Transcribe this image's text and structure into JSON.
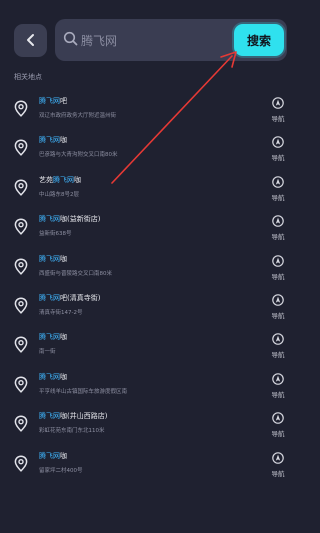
{
  "search": {
    "placeholder": "腾飞网",
    "button_label": "搜索"
  },
  "section_label": "相关地点",
  "results": [
    {
      "pre": "",
      "hl": "腾飞网",
      "post": "吧",
      "address": "双辽市政府政务大厅附近温州街",
      "nav_label": "导航"
    },
    {
      "pre": "",
      "hl": "腾飞网",
      "post": "咖",
      "address": "巴彦路与大青沟附交叉口南80米",
      "nav_label": "导航"
    },
    {
      "pre": "艺苑",
      "hl": "腾飞网",
      "post": "咖",
      "address": "中山路东8号2层",
      "nav_label": "导航"
    },
    {
      "pre": "",
      "hl": "腾飞网",
      "post": "咖(益新街店)",
      "address": "益新街638号",
      "nav_label": "导航"
    },
    {
      "pre": "",
      "hl": "腾飞网",
      "post": "咖",
      "address": "西盛街与晋陵路交叉口南80米",
      "nav_label": "导航"
    },
    {
      "pre": "",
      "hl": "腾飞网",
      "post": "吧(清真寺街)",
      "address": "清真寺街147-2号",
      "nav_label": "导航"
    },
    {
      "pre": "",
      "hl": "腾飞网",
      "post": "咖",
      "address": "南一街",
      "nav_label": "导航"
    },
    {
      "pre": "",
      "hl": "腾飞网",
      "post": "咖",
      "address": "平亨线羊山古镇国际车旅游度假区南",
      "nav_label": "导航"
    },
    {
      "pre": "",
      "hl": "腾飞网",
      "post": "咖(井山西路店)",
      "address": "彩虹花苑东南门东北110米",
      "nav_label": "导航"
    },
    {
      "pre": "",
      "hl": "腾飞网",
      "post": "咖",
      "address": "留家坪二村400号",
      "nav_label": "导航"
    }
  ],
  "colors": {
    "background": "#1f2130",
    "accent": "#2fe1ee",
    "highlight": "#3fb7ff",
    "annotation": "#e53935"
  },
  "icons": {
    "back": "chevron-left-icon",
    "search": "search-icon",
    "pin": "location-pin-icon",
    "nav": "navigation-icon"
  }
}
